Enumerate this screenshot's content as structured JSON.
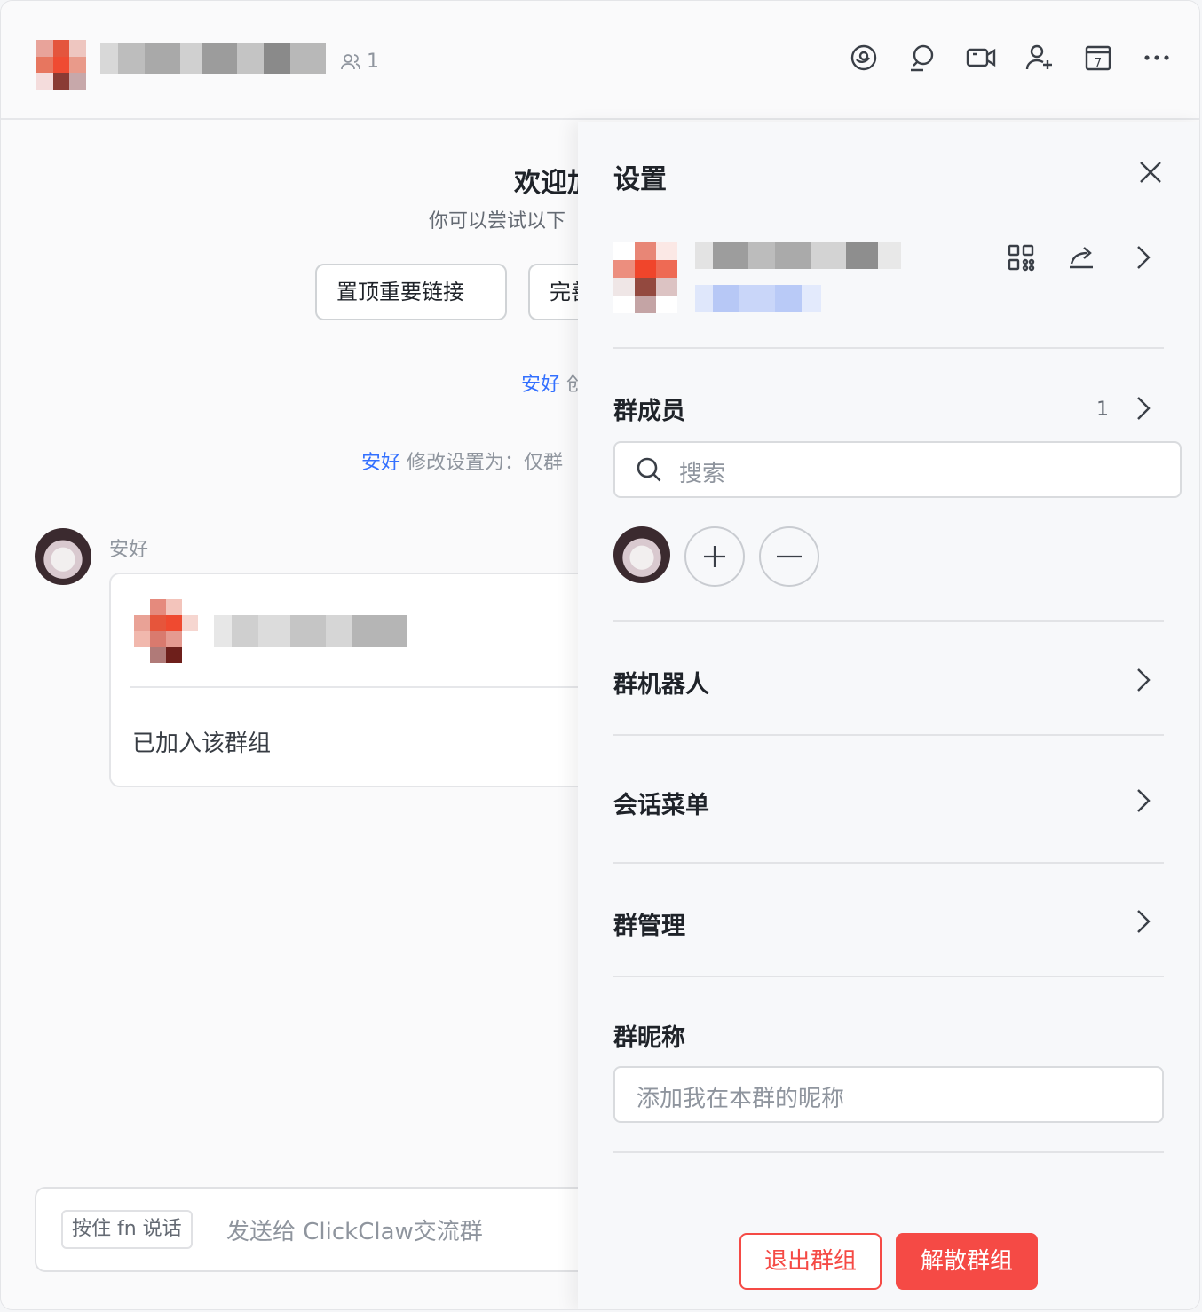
{
  "header": {
    "member_count": "1",
    "icons": [
      "mention-icon",
      "search-chat-icon",
      "video-call-icon",
      "add-member-icon",
      "calendar-icon",
      "more-icon"
    ],
    "calendar_day": "7"
  },
  "chat": {
    "welcome_title": "欢迎加",
    "welcome_subtitle": "你可以尝试以下",
    "chips": [
      "置顶重要链接",
      "完善"
    ],
    "system1": {
      "user": "安好",
      "text": "创"
    },
    "system2": {
      "user": "安好",
      "text": "修改设置为：仅群"
    },
    "message": {
      "sender": "安好",
      "card_text": "已加入该群组"
    },
    "composer": {
      "hold_key": "按住  fn  说话",
      "placeholder": "发送给 ClickClaw交流群"
    }
  },
  "panel": {
    "title": "设置",
    "members": {
      "label": "群成员",
      "count": "1",
      "search_placeholder": "搜索"
    },
    "bots_label": "群机器人",
    "menu_label": "会话菜单",
    "manage_label": "群管理",
    "nickname": {
      "label": "群昵称",
      "placeholder": "添加我在本群的昵称"
    },
    "exit_label": "退出群组",
    "dissolve_label": "解散群组"
  },
  "colors": {
    "accent": "#3370ff",
    "danger": "#f54a45"
  }
}
